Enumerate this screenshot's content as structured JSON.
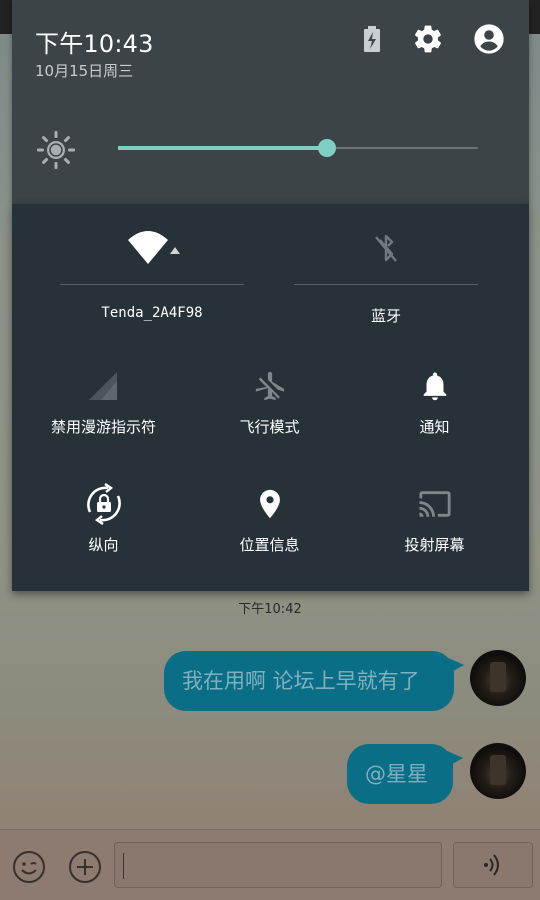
{
  "status": {
    "time": "下午10:43",
    "date": "10月15日周三"
  },
  "header_icons": [
    "battery-charging-icon",
    "settings-icon",
    "account-icon"
  ],
  "brightness": {
    "level": 0.58,
    "accent_color": "#7fcfc4"
  },
  "quick_settings": {
    "wifi": {
      "label": "Tenda_2A4F98",
      "icon": "wifi-icon",
      "active": true
    },
    "bluetooth": {
      "label": "蓝牙",
      "icon": "bluetooth-off-icon",
      "active": false
    },
    "roaming": {
      "label": "禁用漫游指示符",
      "icon": "signal-icon"
    },
    "airplane": {
      "label": "飞行模式",
      "icon": "airplane-off-icon"
    },
    "notifications": {
      "label": "通知",
      "icon": "bell-icon"
    },
    "rotation": {
      "label": "纵向",
      "icon": "rotation-lock-icon"
    },
    "location": {
      "label": "位置信息",
      "icon": "location-pin-icon"
    },
    "cast": {
      "label": "投射屏幕",
      "icon": "cast-icon"
    }
  },
  "chat": {
    "time_divider": "下午10:42",
    "messages": [
      {
        "text": "我在用啊 论坛上早就有了"
      },
      {
        "text": "@星星"
      }
    ],
    "input_placeholder": ""
  },
  "colors": {
    "shade_header": "#3c4448",
    "qs_panel": "#263238",
    "bubble": "#0a6e86"
  }
}
